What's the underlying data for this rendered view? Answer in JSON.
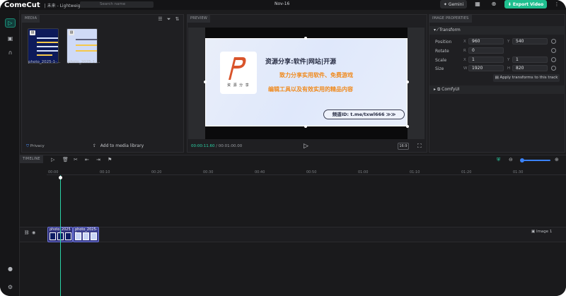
{
  "header": {
    "logo": "ComeCut",
    "subtitle": "| 未来 - Lightweight Video Editor",
    "project_name": "Nov-16",
    "gemini_label": "Gemini",
    "export_label": "Export Video"
  },
  "sidebar": {
    "items": [
      {
        "icon": "media-icon",
        "active": true
      },
      {
        "icon": "image-icon",
        "active": false
      },
      {
        "icon": "magnet-icon",
        "active": false
      },
      {
        "icon": "github-icon",
        "active": false
      },
      {
        "icon": "settings-icon",
        "active": false
      }
    ]
  },
  "media": {
    "tab": "MEDIA",
    "search_placeholder": "Search name",
    "items": [
      {
        "label": "photo_2025-1-…"
      },
      {
        "label": "photo_2025-1-…"
      }
    ],
    "privacy_label": "Privacy",
    "add_label": "Add to media library"
  },
  "preview": {
    "tab": "PREVIEW",
    "current_time": "00:00:11.60",
    "total_time": "/ 00:01:00.00",
    "ratio": "16:9",
    "slide": {
      "title": "资源分享:软件|网站|开源",
      "line1": "致力分享实用软件、免费游戏",
      "line2": "编辑工具以及有效实用的精品内容",
      "contact": "频道ID: t.me/txwl666 ≫≫",
      "logo_text": "资 源 分 享"
    }
  },
  "properties": {
    "tab": "IMAGE PROPERTIES",
    "transform_label": "Transform",
    "position_label": "Position",
    "position_x": "960",
    "position_y": "540",
    "rotate_label": "Rotate",
    "rotate_value": "0",
    "scale_label": "Scale",
    "scale_x": "1",
    "scale_y": "1",
    "size_label": "Size",
    "size_w": "1920",
    "size_h": "820",
    "apply_label": "Apply transforms to this track",
    "comfyui_label": "ComfyUI",
    "axis_x": "X",
    "axis_y": "Y",
    "axis_r": "R",
    "axis_w": "W",
    "axis_h": "H"
  },
  "timeline": {
    "tab": "TIMELINE",
    "ticks": [
      "00:00",
      "00:10",
      "00:20",
      "00:30",
      "00:40",
      "00:50",
      "01:00",
      "01:10",
      "01:20",
      "01:30"
    ],
    "clips": [
      {
        "label": "photo_2025"
      },
      {
        "label": "photo_2025-1"
      }
    ],
    "track_label": "Image 1"
  }
}
